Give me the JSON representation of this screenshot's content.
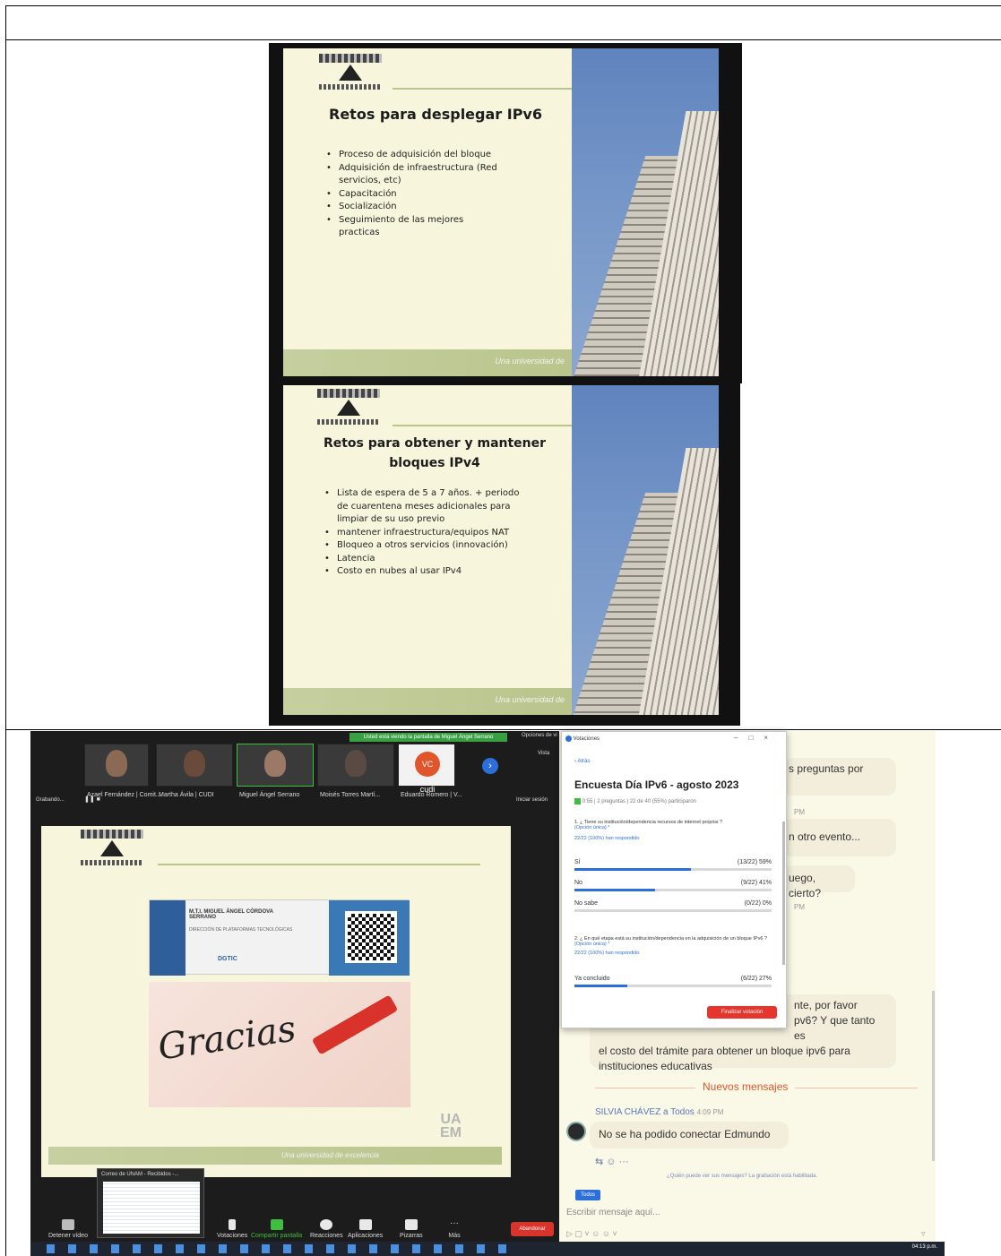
{
  "slide_top": {
    "title": "Retos para desplegar IPv6",
    "bullets": [
      "Proceso de adquisición del bloque",
      "Adquisición de infraestructura (Red servicios, etc)",
      "Capacitación",
      "Socialización",
      "Seguimiento de las mejores practicas"
    ],
    "footer": "Una universidad de"
  },
  "slide_mid": {
    "title": "Retos para obtener y mantener bloques IPv4",
    "bullets": [
      "Lista de espera de 5 a 7 años. + periodo de cuarentena meses adicionales para limpiar de su uso previo",
      "mantener infraestructura/equipos NAT",
      "Bloqueo a otros servicios (innovación)",
      "Latencia",
      "Costo en nubes al usar IPv4"
    ],
    "footer": "Una universidad de"
  },
  "zoom": {
    "banner": "Usted está viendo la pantalla de Miguel Ángel Serrano",
    "view_options": "Opciones de vi",
    "view_label": "Vista",
    "recording": "Grabando...",
    "start_session": "Iniciar sesión",
    "participants": [
      "Azael Fernández | Comit...",
      "Martha Ávila | CUDI",
      "Miguel Ángel Serrano",
      "Moisés Torres Martí...",
      "Eduardo Romero | V..."
    ],
    "participant_badge": "VC cudi",
    "slide_card_name": "M.T.I. MIGUEL ÁNGEL CÓRDOVA SERRANO",
    "slide_card_role": "DIRECCIÓN DE PLATAFORMAS TECNOLÓGICAS",
    "slide_card_org": "DGTIC",
    "gracias": "Gracias",
    "uaem": "UA EM",
    "slide_footer": "Una universidad de excelencia",
    "toolbar": [
      {
        "label": "Detener vídeo"
      },
      {
        "label": "Votaciones"
      },
      {
        "label": "Compartir pantalla"
      },
      {
        "label": "Reacciones"
      },
      {
        "label": "Aplicaciones"
      },
      {
        "label": "Pizarras"
      },
      {
        "label": "Más"
      }
    ],
    "leave": "Abandonar",
    "popup_title": "Correo de UNAM - Recibidos -..."
  },
  "poll": {
    "window_title": "Votaciones",
    "back": "‹ Atrás",
    "title": "Encuesta Día IPv6 - agosto 2023",
    "meta": "0:55 | 2 preguntas | 22 de 40 (55%) participaron",
    "q1": "1. ¿ Tiene su institución/dependencia recursos de internet propios ?",
    "q1_type": "(Opción única) *",
    "q1_answered": "22/22 (100%) han respondido",
    "q1_options": [
      {
        "label": "Sí",
        "value": "(13/22) 59%",
        "pct": 59
      },
      {
        "label": "No",
        "value": "(9/22) 41%",
        "pct": 41
      },
      {
        "label": "No sabe",
        "value": "(0/22) 0%",
        "pct": 0
      }
    ],
    "q2": "2. ¿ En qué etapa está su institución/dependencia en la adquisición de un bloque IPv6 ?",
    "q2_type": "(Opción única) *",
    "q2_answered": "22/22 (100%) han respondido",
    "q2_options": [
      {
        "label": "Ya concluido",
        "value": "(6/22) 27%",
        "pct": 27
      }
    ],
    "end_button": "Finalizar votación"
  },
  "chat": {
    "frag1": "s preguntas por",
    "time1": "PM",
    "frag2": "n otro evento...",
    "frag3": "uego, cierto?",
    "time2": "PM",
    "frag4a": "nte, por favor",
    "frag4b": "pv6? Y que tanto es",
    "frag4c": "el costo del trámite para obtener un bloque ipv6 para",
    "frag4d": "instituciones educativas",
    "new_messages": "Nuevos mensajes",
    "sender": "SILVIA CHÁVEZ a Todos",
    "sender_time": "4:09 PM",
    "message": "No se ha podido conectar Edmundo",
    "notice": "¿Quién puede ver sus mensajes? La grabación está habilitada.",
    "to_label": "Todos",
    "input_placeholder": "Escribir mensaje aquí..."
  },
  "taskbar": {
    "clock": "04:13 p.m."
  }
}
